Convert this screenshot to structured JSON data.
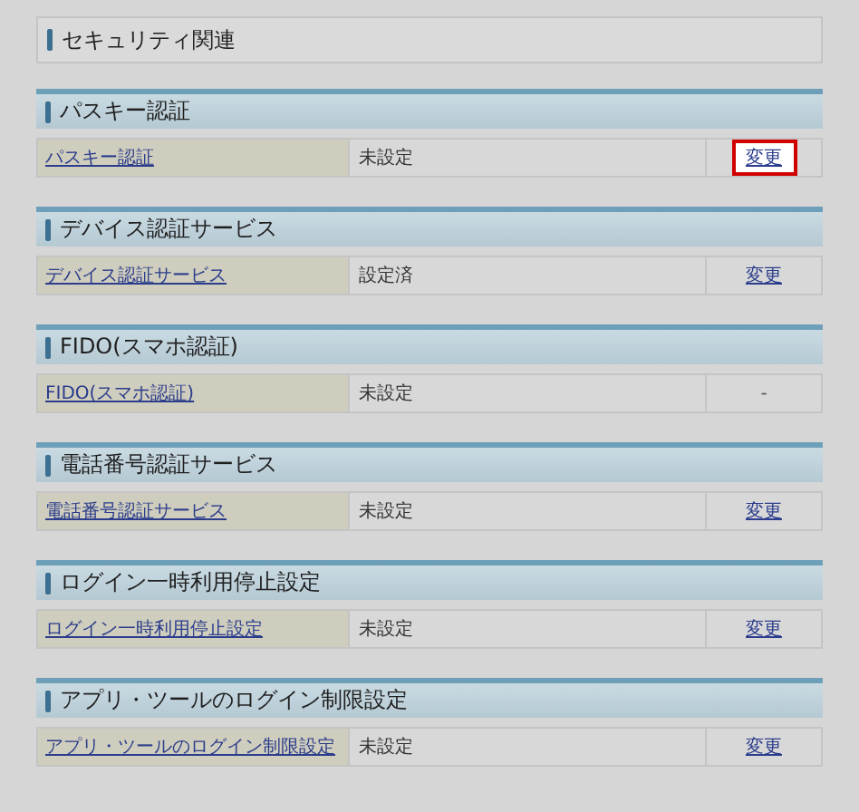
{
  "page_title": "セキュリティ関連",
  "sections": [
    {
      "title": "パスキー認証",
      "row": {
        "label": "パスキー認証",
        "status": "未設定",
        "action": {
          "kind": "link",
          "text": "変更",
          "highlighted": true
        }
      }
    },
    {
      "title": "デバイス認証サービス",
      "row": {
        "label": "デバイス認証サービス",
        "status": "設定済",
        "action": {
          "kind": "link",
          "text": "変更",
          "highlighted": false
        }
      }
    },
    {
      "title": "FIDO(スマホ認証)",
      "row": {
        "label": "FIDO(スマホ認証)",
        "status": "未設定",
        "action": {
          "kind": "text",
          "text": "-",
          "highlighted": false
        }
      }
    },
    {
      "title": "電話番号認証サービス",
      "row": {
        "label": "電話番号認証サービス",
        "status": "未設定",
        "action": {
          "kind": "link",
          "text": "変更",
          "highlighted": false
        }
      }
    },
    {
      "title": "ログイン一時利用停止設定",
      "row": {
        "label": "ログイン一時利用停止設定",
        "status": "未設定",
        "action": {
          "kind": "link",
          "text": "変更",
          "highlighted": false
        }
      }
    },
    {
      "title": "アプリ・ツールのログイン制限設定",
      "row": {
        "label": "アプリ・ツールのログイン制限設定",
        "status": "未設定",
        "action": {
          "kind": "link",
          "text": "変更",
          "highlighted": false
        }
      }
    }
  ]
}
